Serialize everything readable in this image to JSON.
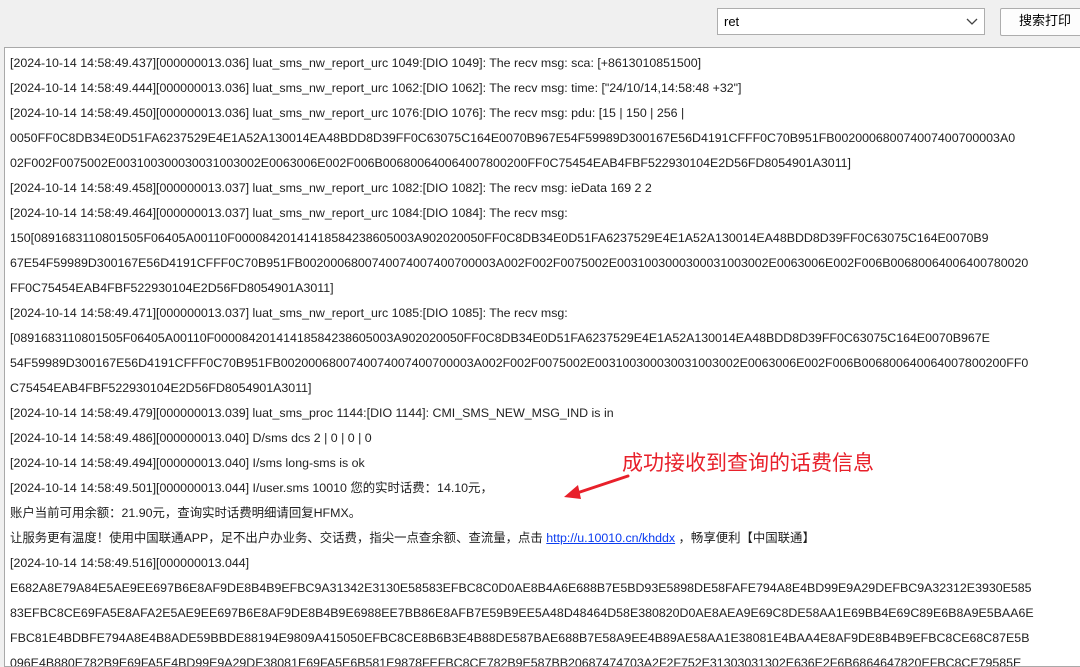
{
  "toolbar": {
    "search_value": "ret",
    "search_button_label": "搜索打印",
    "dropdown_icon": "chevron-down-icon"
  },
  "log": {
    "lines": [
      "[2024-10-14 14:58:49.437][000000013.036] luat_sms_nw_report_urc 1049:[DIO 1049]: The recv msg: sca: [+8613010851500]",
      "[2024-10-14 14:58:49.444][000000013.036] luat_sms_nw_report_urc 1062:[DIO 1062]: The recv msg: time: [\"24/10/14,14:58:48 +32\"]",
      "[2024-10-14 14:58:49.450][000000013.036] luat_sms_nw_report_urc 1076:[DIO 1076]: The recv msg: pdu: [15 | 150 | 256 |",
      "0050FF0C8DB34E0D51FA6237529E4E1A52A130014EA48BDD8D39FF0C63075C164E0070B967E54F59989D300167E56D4191CFFF0C70B951FB002000680074007400700003A0",
      "02F002F0075002E003100300030031003002E0063006E002F006B006800640064007800200FF0C75454EAB4FBF522930104E2D56FD8054901A3011]",
      "[2024-10-14 14:58:49.458][000000013.037] luat_sms_nw_report_urc 1082:[DIO 1082]: The recv msg: ieData 169 2 2",
      "[2024-10-14 14:58:49.464][000000013.037] luat_sms_nw_report_urc 1084:[DIO 1084]: The recv msg:",
      "150[0891683110801505F06405A00110F00008420141418584238605003A902020050FF0C8DB34E0D51FA6237529E4E1A52A130014EA48BDD8D39FF0C63075C164E0070B9",
      "67E54F59989D300167E56D4191CFFF0C70B951FB0020006800740074007400700003A002F002F0075002E0031003000300031003002E0063006E002F006B00680064006400780020",
      "FF0C75454EAB4FBF522930104E2D56FD8054901A3011]",
      "[2024-10-14 14:58:49.471][000000013.037] luat_sms_nw_report_urc 1085:[DIO 1085]: The recv msg:",
      "[0891683110801505F06405A00110F00008420141418584238605003A902020050FF0C8DB34E0D51FA6237529E4E1A52A130014EA48BDD8D39FF0C63075C164E0070B967E",
      "54F59989D300167E56D4191CFFF0C70B951FB0020006800740074007400700003A002F002F0075002E003100300030031003002E0063006E002F006B006800640064007800200FF0",
      "C75454EAB4FBF522930104E2D56FD8054901A3011]",
      "[2024-10-14 14:58:49.479][000000013.039] luat_sms_proc 1144:[DIO 1144]: CMI_SMS_NEW_MSG_IND is in",
      "[2024-10-14 14:58:49.486][000000013.040] D/sms dcs 2 | 0 | 0 | 0",
      "[2024-10-14 14:58:49.494][000000013.040] I/sms long-sms is ok",
      "[2024-10-14 14:58:49.501][000000013.044] I/user.sms        10010    您的实时话费：14.10元，",
      "账户当前可用余额：21.90元，查询实时话费明细请回复HFMX。",
      "",
      "[2024-10-14 14:58:49.516][000000013.044]",
      "E682A8E79A84E5AE9EE697B6E8AF9DE8B4B9EFBC9A31342E3130E58583EFBC8C0D0AE8B4A6E688B7E5BD93E5898DE58FAFE794A8E4BD99E9A29DEFBC9A32312E3930E585",
      "83EFBC8CE69FA5E8AFA2E5AE9EE697B6E8AF9DE8B4B9E6988EE7BB86E8AFB7E59B9EE5A48D48464D58E380820D0AE8AEA9E69C8DE58AA1E69BB4E69C89E6B8A9E5BAA6E",
      "FBC81E4BDBFE794A8E4B8ADE59BBDE88194E9809A415050EFBC8CE8B6B3E4B88DE587BAE688B7E58A9EE4B89AE58AA1E38081E4BAA4E8AF9DE8B4B9EFBC8CE68C87E5B",
      "096E4B880E782B9E69FA5E4BD99E9A29DE38081E69FA5E6B581E9878FEFBC8CE782B9E587BB20687474703A2F2F752E31303031302E636E2F6B6864647820EFBC8CE79585E"
    ],
    "service_prefix": "让服务更有温度！使用中国联通APP，足不出户办业务、交话费，指尖一点查余额、查流量，点击 ",
    "service_link": "http://u.10010.cn/khddx",
    "service_suffix": " ，畅享便利【中国联通】"
  },
  "annotation": {
    "text": "成功接收到查询的话费信息",
    "color": "#e8202a"
  }
}
